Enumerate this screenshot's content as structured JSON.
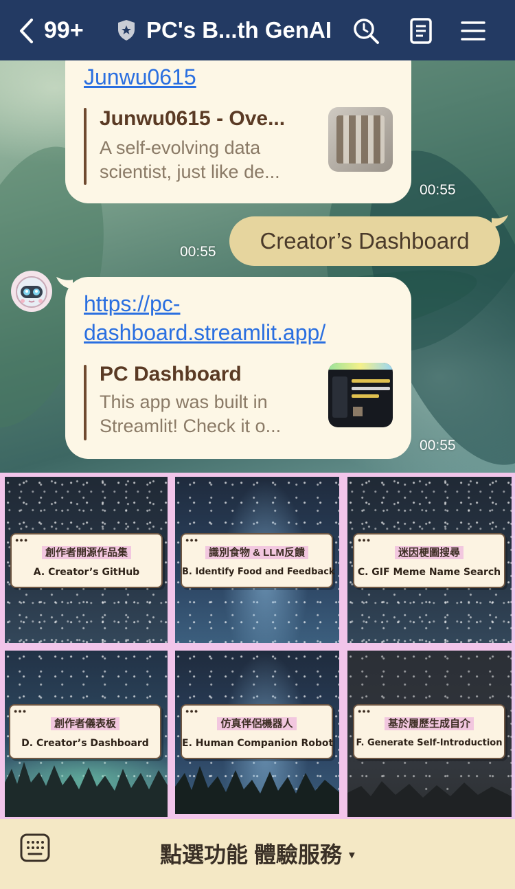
{
  "header": {
    "back_count": "99+",
    "title": "PC's B...th GenAI",
    "icons": [
      "chevron-left-icon",
      "shield-star-icon",
      "search-icon",
      "notes-icon",
      "menu-icon"
    ]
  },
  "messages": {
    "first": {
      "link_text": "Junwu0615",
      "card_title": "Junwu0615 - Ove...",
      "card_desc_1": "A self-evolving data",
      "card_desc_2": "scientist, just like de...",
      "time": "00:55"
    },
    "outgoing": {
      "text": "Creator’s Dashboard",
      "time": "00:55"
    },
    "second": {
      "link_text_1": "https://pc-",
      "link_text_2": "dashboard.streamlit.app/",
      "card_title": "PC Dashboard",
      "card_desc_1": "This app was built in",
      "card_desc_2": "Streamlit! Check it o...",
      "time": "00:55"
    }
  },
  "rich_menu": {
    "tiles": [
      {
        "zh": "創作者開源作品集",
        "en": "A. Creator’s GitHub"
      },
      {
        "zh": "識別食物 & LLM反饋",
        "en": "B. Identify Food and Feedback"
      },
      {
        "zh": "迷因梗圖搜尋",
        "en": "C.  GIF Meme Name Search"
      },
      {
        "zh": "創作者儀表板",
        "en": "D. Creator’s Dashboard"
      },
      {
        "zh": "仿真伴侶機器人",
        "en": "E. Human Companion Robot"
      },
      {
        "zh": "基於履歷生成自介",
        "en": "F. Generate Self-Introduction"
      }
    ]
  },
  "bottom_bar": {
    "label": "點選功能 體驗服務",
    "arrow": "▾"
  },
  "colors": {
    "header_bg": "#233a63",
    "bubble_bg": "#fdf7e6",
    "outgoing_bubble_bg": "#e6d59e",
    "link": "#2a6fe0",
    "menu_border": "#f2c5ea",
    "bottom_bar_bg": "#f4e8c5"
  }
}
